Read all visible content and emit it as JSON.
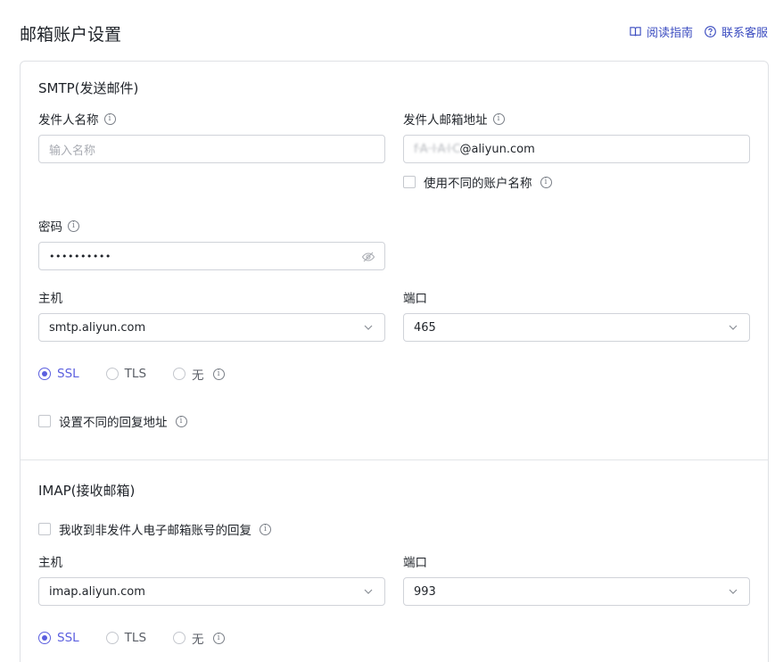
{
  "page": {
    "title": "邮箱账户设置",
    "links": {
      "guide": "阅读指南",
      "support": "联系客服"
    }
  },
  "smtp": {
    "title": "SMTP(发送邮件)",
    "sender_name": {
      "label": "发件人名称",
      "placeholder": "输入名称",
      "value": ""
    },
    "sender_email": {
      "label": "发件人邮箱地址",
      "value_masked": "f·A··l·A·l·C",
      "value_domain": "@aliyun.com"
    },
    "diff_account_name": {
      "label": "使用不同的账户名称",
      "checked": false
    },
    "password": {
      "label": "密码",
      "value": "••••••••••"
    },
    "host": {
      "label": "主机",
      "value": "smtp.aliyun.com"
    },
    "port": {
      "label": "端口",
      "value": "465"
    },
    "security": {
      "options": [
        "SSL",
        "TLS",
        "无"
      ],
      "selected": "SSL"
    },
    "reply_to": {
      "label": "设置不同的回复地址",
      "checked": false
    }
  },
  "imap": {
    "title": "IMAP(接收邮箱)",
    "non_sender_reply": {
      "label": "我收到非发件人电子邮箱账号的回复",
      "checked": false
    },
    "host": {
      "label": "主机",
      "value": "imap.aliyun.com"
    },
    "port": {
      "label": "端口",
      "value": "993"
    },
    "security": {
      "options": [
        "SSL",
        "TLS",
        "无"
      ],
      "selected": "SSL"
    }
  },
  "colors": {
    "accent": "#5b5fdf",
    "link": "#3b4cc0",
    "border": "#d0d3d9"
  },
  "icons": {
    "guide": "book-icon",
    "support": "question-circle-icon",
    "info": "info-circle-icon",
    "select": "chevron-down-icon",
    "password": "eye-off-icon"
  }
}
